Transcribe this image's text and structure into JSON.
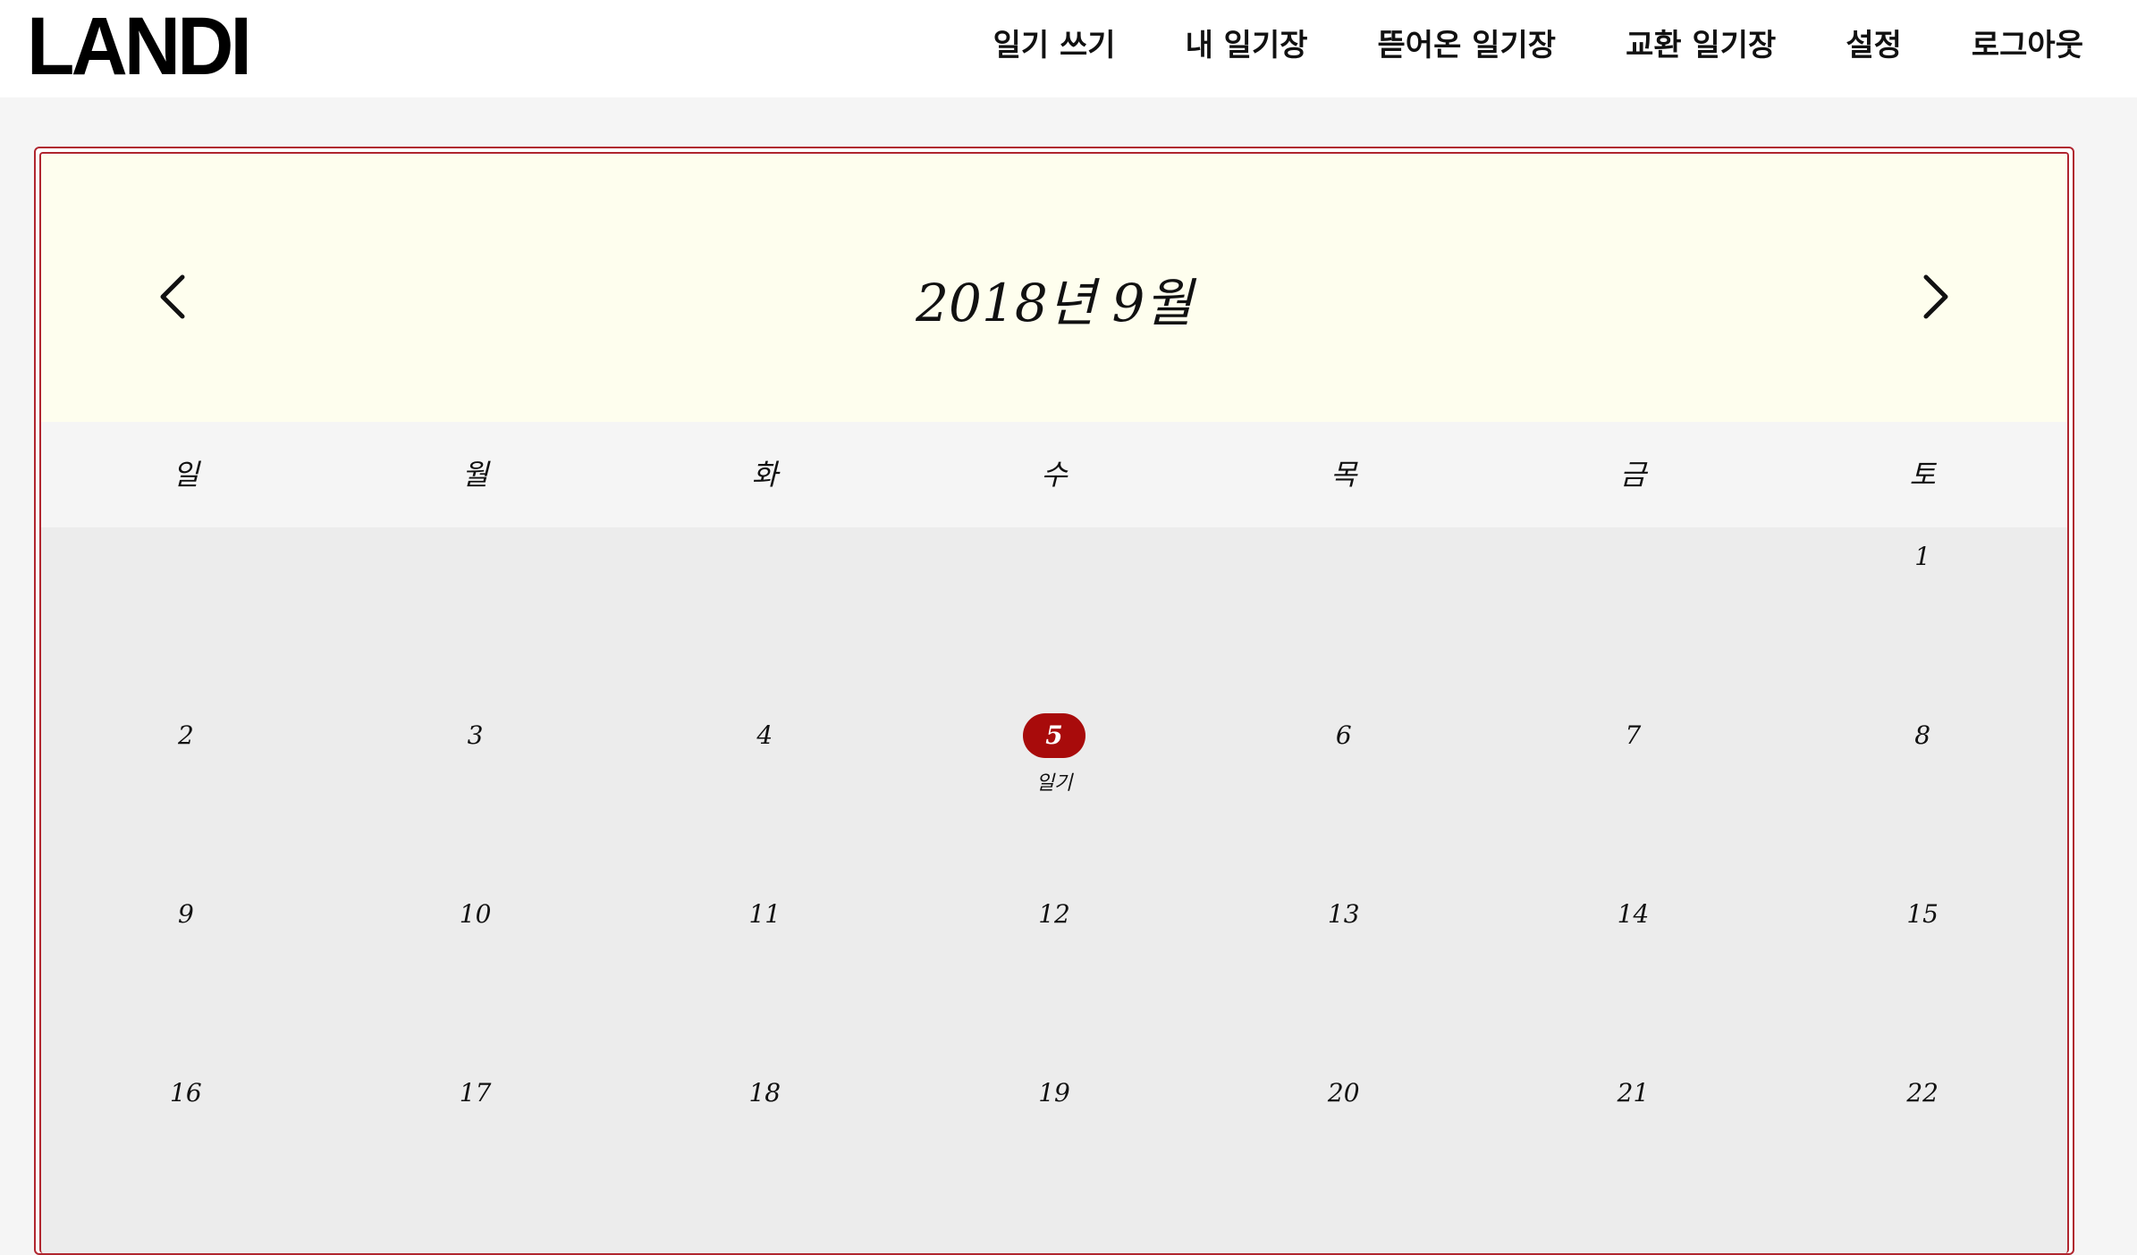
{
  "brand": {
    "logo": "LANDI"
  },
  "nav": {
    "items": [
      "일기 쓰기",
      "내 일기장",
      "뜯어온 일기장",
      "교환 일기장",
      "설정",
      "로그아웃"
    ]
  },
  "calendar": {
    "title": "2018년 9월",
    "weekdays": [
      "일",
      "월",
      "화",
      "수",
      "목",
      "금",
      "토"
    ],
    "weeks": [
      [
        "",
        "",
        "",
        "",
        "",
        "",
        "1"
      ],
      [
        "2",
        "3",
        "4",
        "5",
        "6",
        "7",
        "8"
      ],
      [
        "9",
        "10",
        "11",
        "12",
        "13",
        "14",
        "15"
      ],
      [
        "16",
        "17",
        "18",
        "19",
        "20",
        "21",
        "22"
      ]
    ],
    "today": "5",
    "notes": {
      "5": "일기"
    },
    "colors": {
      "accent": "#a80b0b",
      "frame": "#b0262f",
      "header_bg": "#fefeee"
    }
  }
}
